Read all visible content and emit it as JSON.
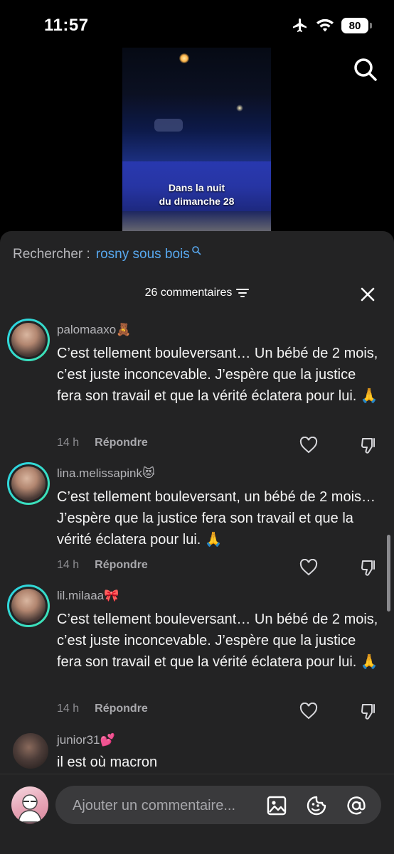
{
  "status_bar": {
    "time": "11:57",
    "battery": "80",
    "icons": [
      "airplane-icon",
      "wifi-icon",
      "battery-icon"
    ]
  },
  "video": {
    "caption_line1": "Dans la nuit",
    "caption_line2": "du dimanche 28"
  },
  "search": {
    "label": "Rechercher :",
    "query": "rosny sous bois"
  },
  "comments_header": {
    "count_label": "26 commentaires"
  },
  "comments": [
    {
      "username": "palomaaxo🧸",
      "text": "C’est tellement bouleversant… Un bébé de 2 mois, c’est juste inconcevable. J’espère que la justice fera son travail et que la vérité éclatera pour lui. 🙏",
      "time": "14 h",
      "reply_label": "Répondre"
    },
    {
      "username": "lina.melissapink😻",
      "text": "C’est tellement bouleversant, un bébé de 2 mois… J’espère que la justice fera son travail et que la vérité éclatera pour lui. 🙏",
      "time": "14 h",
      "reply_label": "Répondre"
    },
    {
      "username": "lil.milaaa🎀",
      "text": "C’est tellement bouleversant… Un bébé de 2 mois, c’est juste inconcevable. J’espère que la justice fera son travail et que la vérité éclatera pour lui. 🙏",
      "time": "14 h",
      "reply_label": "Répondre"
    },
    {
      "username": "junior31💕",
      "text": "il est où macron"
    }
  ],
  "composer": {
    "placeholder": "Ajouter un commentaire..."
  },
  "colors": {
    "sheet_bg": "#232324",
    "search_query": "#58a9f0",
    "avatar_ring": "#2bd4e8"
  }
}
